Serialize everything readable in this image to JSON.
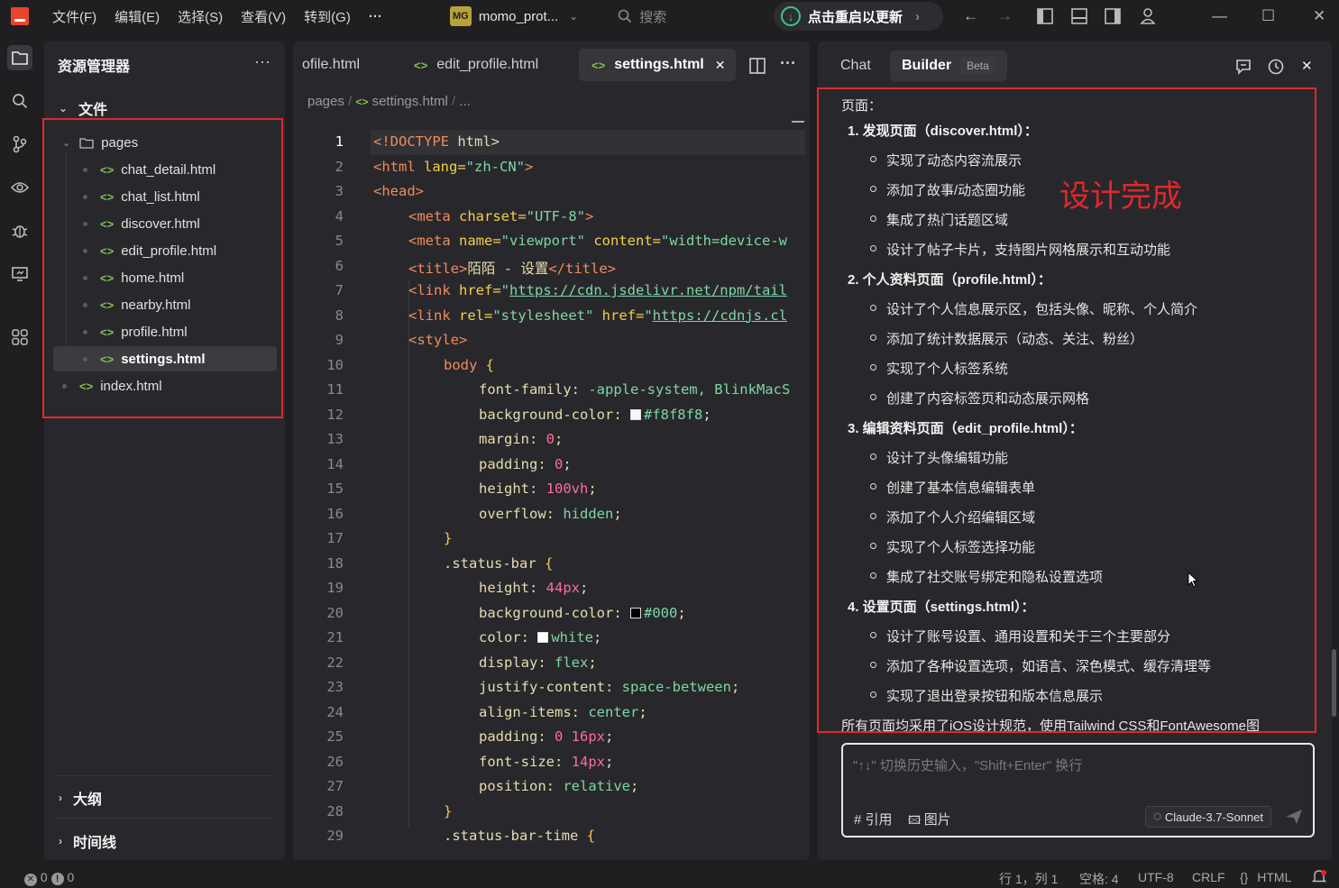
{
  "titlebar": {
    "menus": [
      "文件(F)",
      "编辑(E)",
      "选择(S)",
      "查看(V)",
      "转到(G)"
    ],
    "more": "···",
    "project_badge": "MG",
    "project_name": "momo_prot...",
    "search_placeholder": "搜索",
    "update_label": "点击重启以更新"
  },
  "explorer": {
    "title": "资源管理器",
    "more": "···",
    "files_section": "文件",
    "folder": "pages",
    "files": [
      "chat_detail.html",
      "chat_list.html",
      "discover.html",
      "edit_profile.html",
      "home.html",
      "nearby.html",
      "profile.html",
      "settings.html"
    ],
    "selected_file": "settings.html",
    "root_file": "index.html",
    "outline_section": "大纲",
    "timeline_section": "时间线"
  },
  "editor": {
    "tabs": [
      "ofile.html",
      "edit_profile.html",
      "settings.html"
    ],
    "active_tab": "settings.html",
    "close": "✕",
    "breadcrumb": [
      "pages",
      "settings.html",
      "..."
    ],
    "line_numbers": [
      "1",
      "2",
      "3",
      "4",
      "5",
      "6",
      "7",
      "8",
      "9",
      "10",
      "11",
      "12",
      "13",
      "14",
      "15",
      "16",
      "17",
      "18",
      "19",
      "20",
      "21",
      "22",
      "23",
      "24",
      "25",
      "26",
      "27",
      "28",
      "29"
    ],
    "code": {
      "l1": [
        "<!DOCTYPE",
        " html>"
      ],
      "l2": [
        "<html",
        " lang=",
        "\"zh-CN\"",
        ">"
      ],
      "l3": "<head>",
      "l4": [
        "<meta",
        " charset=",
        "\"UTF-8\"",
        ">"
      ],
      "l5": [
        "<meta",
        " name=",
        "\"viewport\"",
        " content=",
        "\"width=device-w"
      ],
      "l6": [
        "<title>",
        "陌陌 - 设置",
        "</title>"
      ],
      "l7": [
        "<link",
        " href=",
        "\"",
        "https://cdn.jsdelivr.net/npm/tail"
      ],
      "l8": [
        "<link",
        " rel=",
        "\"stylesheet\"",
        " href=",
        "\"",
        "https://cdnjs.cl"
      ],
      "l9": "<style>",
      "l10": [
        "body",
        " {"
      ],
      "l11": [
        "font-family",
        ": ",
        "-apple-system, BlinkMacS"
      ],
      "l12": [
        "background-color",
        ": ",
        "#f8f8f8",
        ";"
      ],
      "l13": [
        "margin",
        ": ",
        "0",
        ";"
      ],
      "l14": [
        "padding",
        ": ",
        "0",
        ";"
      ],
      "l15": [
        "height",
        ": ",
        "100vh",
        ";"
      ],
      "l16": [
        "overflow",
        ": ",
        "hidden",
        ";"
      ],
      "l17": "}",
      "l18": [
        ".status-bar",
        " {"
      ],
      "l19": [
        "height",
        ": ",
        "44px",
        ";"
      ],
      "l20": [
        "background-color",
        ": ",
        "#000",
        ";"
      ],
      "l21": [
        "color",
        ": ",
        "white",
        ";"
      ],
      "l22": [
        "display",
        ": ",
        "flex",
        ";"
      ],
      "l23": [
        "justify-content",
        ": ",
        "space-between",
        ";"
      ],
      "l24": [
        "align-items",
        ": ",
        "center",
        ";"
      ],
      "l25": [
        "padding",
        ": ",
        "0 16px",
        ";"
      ],
      "l26": [
        "font-size",
        ": ",
        "14px",
        ";"
      ],
      "l27": [
        "position",
        ": ",
        "relative",
        ";"
      ],
      "l28": "}",
      "l29": [
        ".status-bar-time",
        " {"
      ]
    },
    "swatch_colors": {
      "f8": "#f8f8f8",
      "black": "#000000",
      "white": "#ffffff"
    }
  },
  "panel": {
    "tabs": [
      "Chat",
      "Builder"
    ],
    "beta": "Beta",
    "intro": "页面：",
    "annotation": "设计完成",
    "sections": [
      {
        "title": "1. 发现页面（discover.html）：",
        "items": [
          "实现了动态内容流展示",
          "添加了故事/动态圈功能",
          "集成了热门话题区域",
          "设计了帖子卡片，支持图片网格展示和互动功能"
        ]
      },
      {
        "title": "2. 个人资料页面（profile.html）：",
        "items": [
          "设计了个人信息展示区，包括头像、昵称、个人简介",
          "添加了统计数据展示（动态、关注、粉丝）",
          "实现了个人标签系统",
          "创建了内容标签页和动态展示网格"
        ]
      },
      {
        "title": "3. 编辑资料页面（edit_profile.html）：",
        "items": [
          "设计了头像编辑功能",
          "创建了基本信息编辑表单",
          "添加了个人介绍编辑区域",
          "实现了个人标签选择功能",
          "集成了社交账号绑定和隐私设置选项"
        ]
      },
      {
        "title": "4. 设置页面（settings.html）：",
        "items": [
          "设计了账号设置、通用设置和关于三个主要部分",
          "添加了各种设置选项，如语言、深色模式、缓存清理等",
          "实现了退出登录按钮和版本信息展示"
        ]
      }
    ],
    "footer": "所有页面均采用了iOS设计规范，使用Tailwind CSS和FontAwesome图",
    "input_placeholder": "\"↑↓\" 切换历史输入，\"Shift+Enter\" 换行",
    "reference": "引用",
    "image": "图片",
    "model": "Claude-3.7-Sonnet"
  },
  "statusbar": {
    "errors": "0",
    "warnings": "0",
    "position": "行 1，列 1",
    "spaces": "空格: 4",
    "encoding": "UTF-8",
    "eol": "CRLF",
    "language": "HTML"
  },
  "colors": {
    "accent_red": "#e0282c",
    "green": "#39c58b",
    "html_icon": "#7fc24b"
  }
}
